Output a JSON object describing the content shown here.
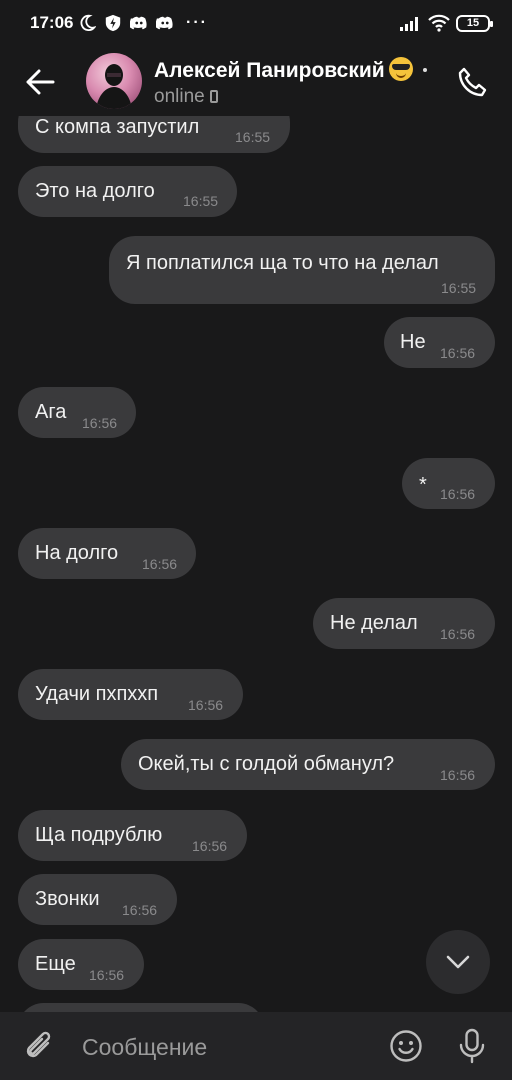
{
  "status_bar": {
    "time": "17:06",
    "battery": "15",
    "more": "···"
  },
  "header": {
    "contact_name": "Алексей Панировский",
    "status": "online"
  },
  "messages": [
    {
      "text": "С компа запустил",
      "time": "16:55",
      "direction": "in"
    },
    {
      "text": "Это на долго",
      "time": "16:55",
      "direction": "in"
    },
    {
      "text": "Я поплатился ща то что на делал",
      "time": "16:55",
      "direction": "out"
    },
    {
      "text": "Не",
      "time": "16:56",
      "direction": "out"
    },
    {
      "text": "Ага",
      "time": "16:56",
      "direction": "in"
    },
    {
      "text": "*",
      "time": "16:56",
      "direction": "out"
    },
    {
      "text": "На долго",
      "time": "16:56",
      "direction": "in"
    },
    {
      "text": "Не делал",
      "time": "16:56",
      "direction": "out"
    },
    {
      "text": "Удачи пхпхxп",
      "time": "16:56",
      "direction": "in"
    },
    {
      "text": "Окей,ты с голдой обманул?",
      "time": "16:56",
      "direction": "out"
    },
    {
      "text": "Ща подрублю",
      "time": "16:56",
      "direction": "in"
    },
    {
      "text": "Звонки",
      "time": "16:56",
      "direction": "in"
    },
    {
      "text": "Еще",
      "time": "16:56",
      "direction": "in"
    }
  ],
  "composer": {
    "placeholder": "Сообщение"
  },
  "colors": {
    "background": "#19191a",
    "bubble": "#3a3a3c",
    "composer": "#242426",
    "timestamp": "#8a8a8c"
  }
}
